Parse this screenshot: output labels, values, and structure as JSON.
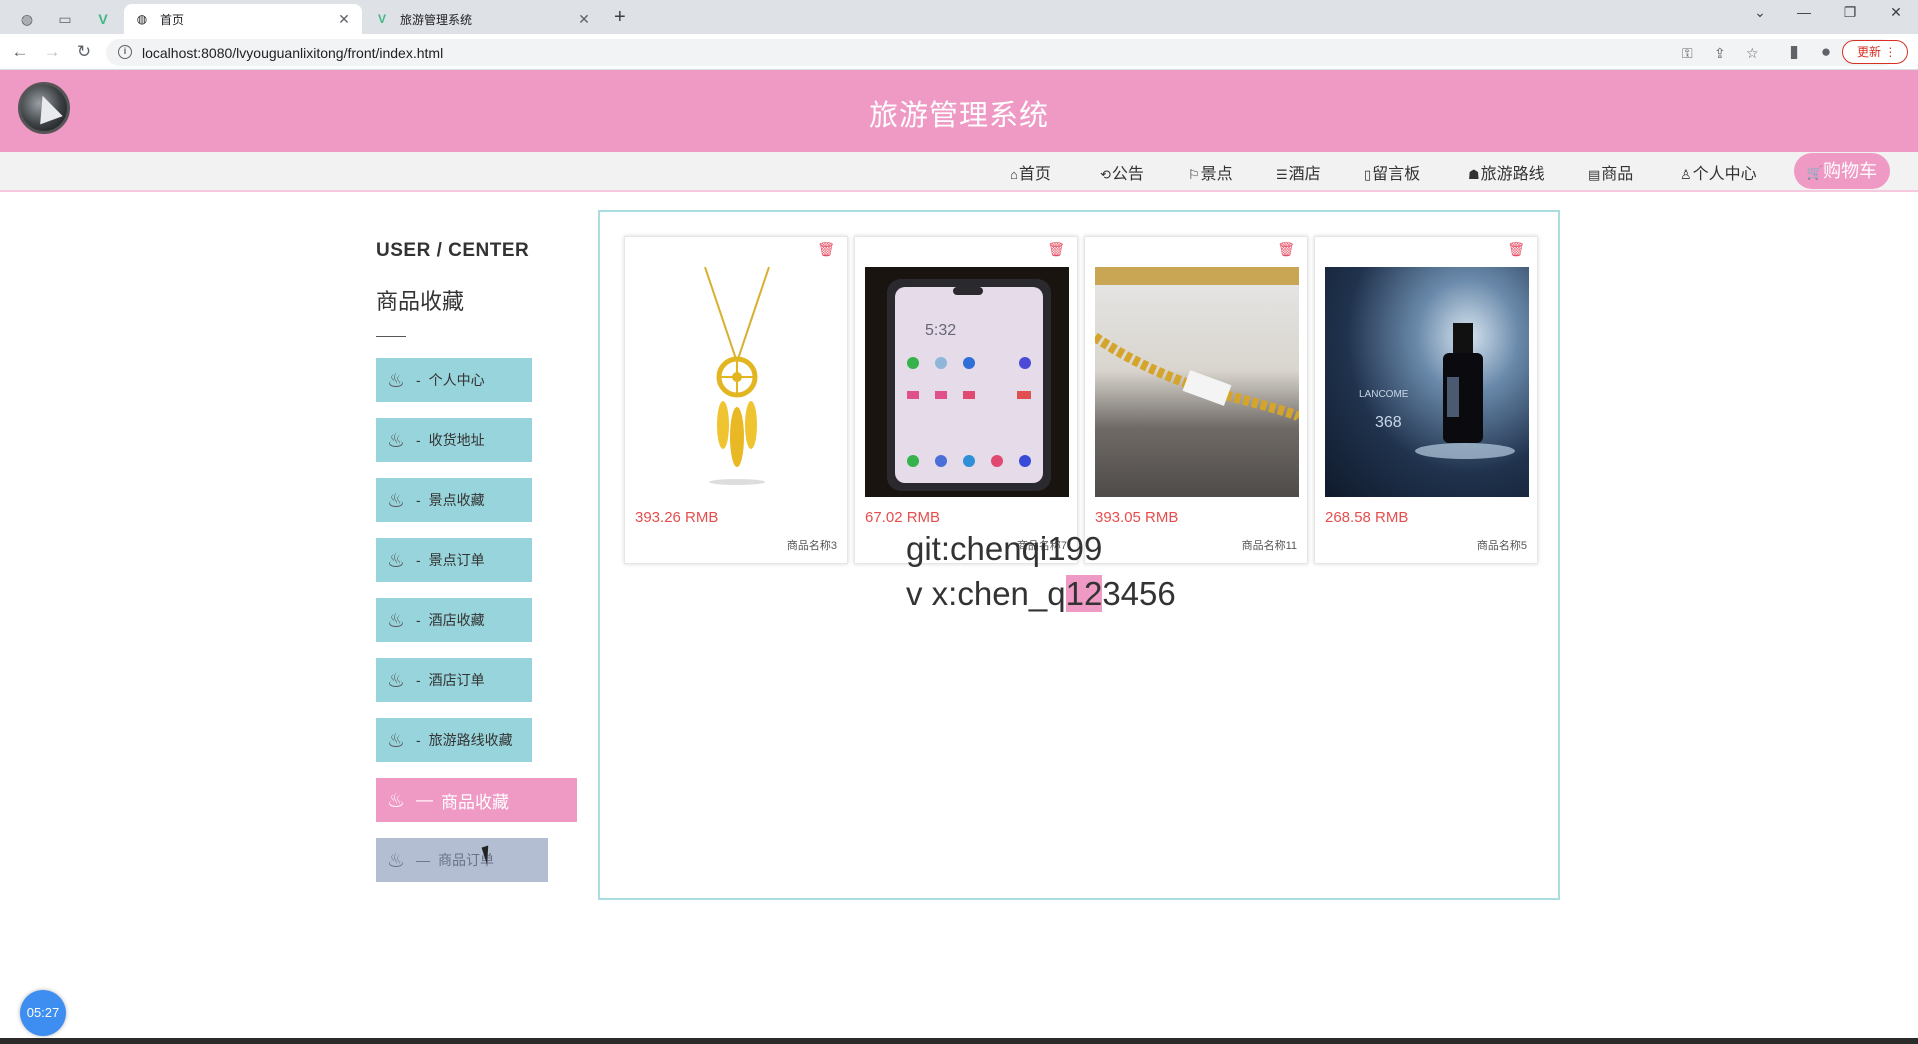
{
  "browser": {
    "tabs": [
      {
        "title": "首页",
        "active": true
      },
      {
        "title": "旅游管理系统",
        "active": false
      }
    ],
    "url": "localhost:8080/lvyouguanlixitong/front/index.html",
    "update_label": "更新"
  },
  "header": {
    "title": "旅游管理系统"
  },
  "nav": {
    "items": [
      {
        "icon": "⌂",
        "label": "首页"
      },
      {
        "icon": "⟲",
        "label": "公告"
      },
      {
        "icon": "⚐",
        "label": "景点"
      },
      {
        "icon": "☰",
        "label": "酒店"
      },
      {
        "icon": "▯",
        "label": "留言板"
      },
      {
        "icon": "☗",
        "label": "旅游路线"
      },
      {
        "icon": "▤",
        "label": "商品"
      },
      {
        "icon": "♙",
        "label": "个人中心"
      }
    ],
    "cart": {
      "icon": "🛒",
      "label": "购物车"
    }
  },
  "sidebar": {
    "heading": "USER / CENTER",
    "subheading": "商品收藏",
    "items": [
      {
        "label": "个人中心",
        "dash": "-"
      },
      {
        "label": "收货地址",
        "dash": "-"
      },
      {
        "label": "景点收藏",
        "dash": "-"
      },
      {
        "label": "景点订单",
        "dash": "-"
      },
      {
        "label": "酒店收藏",
        "dash": "-"
      },
      {
        "label": "酒店订单",
        "dash": "-"
      },
      {
        "label": "旅游路线收藏",
        "dash": "-"
      },
      {
        "label": "商品收藏",
        "dash": "—"
      },
      {
        "label": "商品订单",
        "dash": "—"
      }
    ]
  },
  "products": [
    {
      "price": "393.26 RMB",
      "name": "商品名称3",
      "image": "gold-dreamcatcher-necklace"
    },
    {
      "price": "67.02 RMB",
      "name": "商品名称7",
      "image": "smartphone"
    },
    {
      "price": "393.05 RMB",
      "name": "商品名称11",
      "image": "gold-chain"
    },
    {
      "price": "268.58 RMB",
      "name": "商品名称5",
      "image": "lancome-serum"
    }
  ],
  "watermark": {
    "line1": "git:chenqi199",
    "line2_pre": "v x:chen_q",
    "line2_hl": "12",
    "line2_post": "3456"
  },
  "clock": "05:27",
  "colors": {
    "brand_pink": "#ef99c5",
    "sidebar_teal": "#98d4db",
    "price_red": "#e64d4d"
  }
}
